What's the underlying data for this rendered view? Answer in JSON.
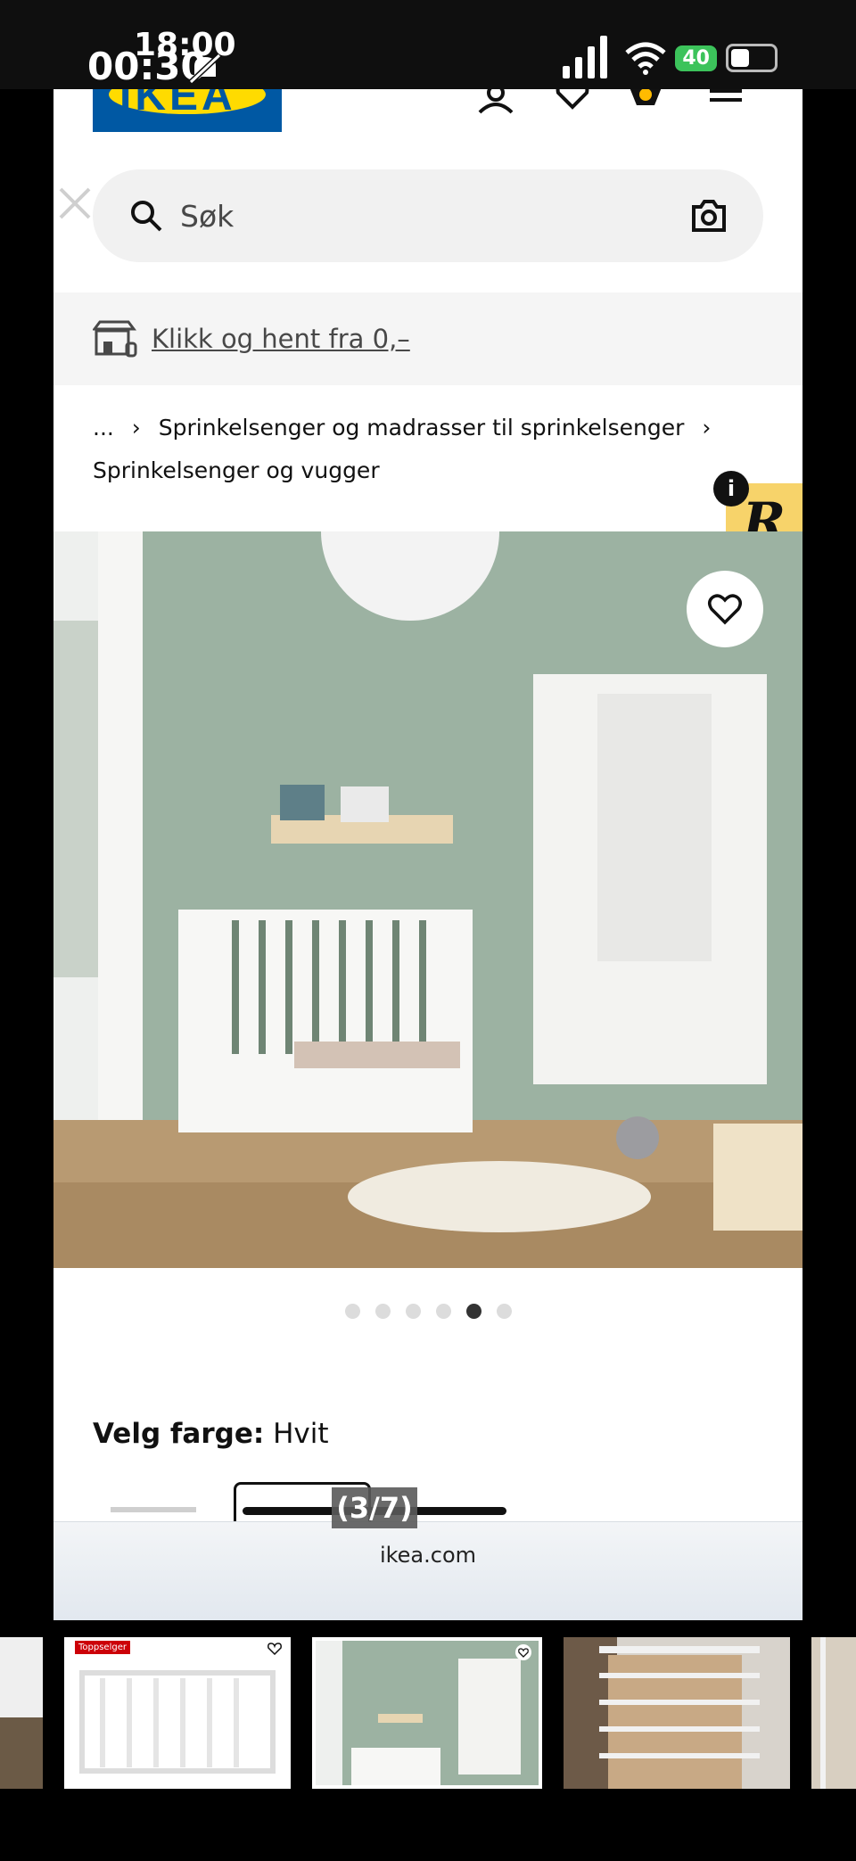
{
  "status": {
    "time_primary": "18:00",
    "time_secondary": "00:30",
    "battery": "40"
  },
  "header": {
    "logo": "IKEA",
    "icons": [
      "account-icon",
      "heart-icon",
      "bag-icon",
      "menu-icon"
    ]
  },
  "search": {
    "placeholder": "Søk"
  },
  "banner": {
    "text": "Klikk og hent fra 0,–"
  },
  "breadcrumb": {
    "items": [
      "...",
      "Sprinkelsenger og madrasser til sprinkelsenger",
      "Sprinkelsenger og vugger"
    ]
  },
  "gallery": {
    "slides": 6,
    "active": 5
  },
  "color": {
    "label": "Velg farge:",
    "value": "Hvit"
  },
  "browser": {
    "url": "ikea.com",
    "counter": "(3/7)"
  },
  "thumbnails": [
    {
      "badge": "Toppselger"
    },
    {
      "badge": ""
    }
  ],
  "colors": {
    "brand_blue": "#0058a3",
    "brand_yellow": "#ffdb00",
    "badge_red": "#cc0008"
  }
}
